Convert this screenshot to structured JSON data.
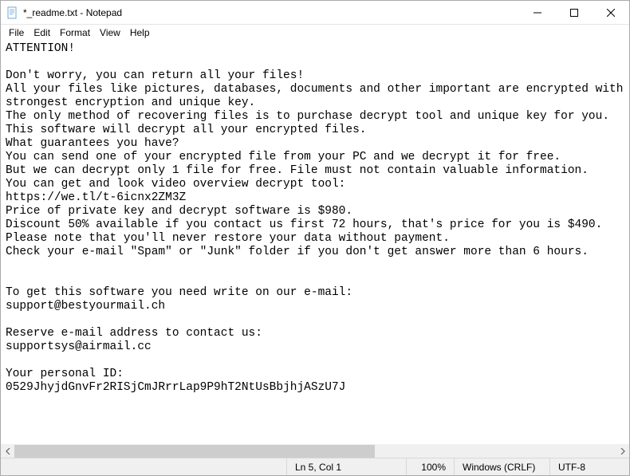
{
  "title": "*_readme.txt - Notepad",
  "menu": {
    "file": "File",
    "edit": "Edit",
    "format": "Format",
    "view": "View",
    "help": "Help"
  },
  "content": "ATTENTION!\n\nDon't worry, you can return all your files!\nAll your files like pictures, databases, documents and other important are encrypted with strongest encryption and unique key.\nThe only method of recovering files is to purchase decrypt tool and unique key for you.\nThis software will decrypt all your encrypted files.\nWhat guarantees you have?\nYou can send one of your encrypted file from your PC and we decrypt it for free.\nBut we can decrypt only 1 file for free. File must not contain valuable information.\nYou can get and look video overview decrypt tool:\nhttps://we.tl/t-6icnx2ZM3Z\nPrice of private key and decrypt software is $980.\nDiscount 50% available if you contact us first 72 hours, that's price for you is $490.\nPlease note that you'll never restore your data without payment.\nCheck your e-mail \"Spam\" or \"Junk\" folder if you don't get answer more than 6 hours.\n\n\nTo get this software you need write on our e-mail:\nsupport@bestyourmail.ch\n\nReserve e-mail address to contact us:\nsupportsys@airmail.cc\n\nYour personal ID:\n0529JhyjdGnvFr2RISjCmJRrrLap9P9hT2NtUsBbjhjASzU7J",
  "status": {
    "position": "Ln 5, Col 1",
    "zoom": "100%",
    "eol": "Windows (CRLF)",
    "encoding": "UTF-8"
  }
}
